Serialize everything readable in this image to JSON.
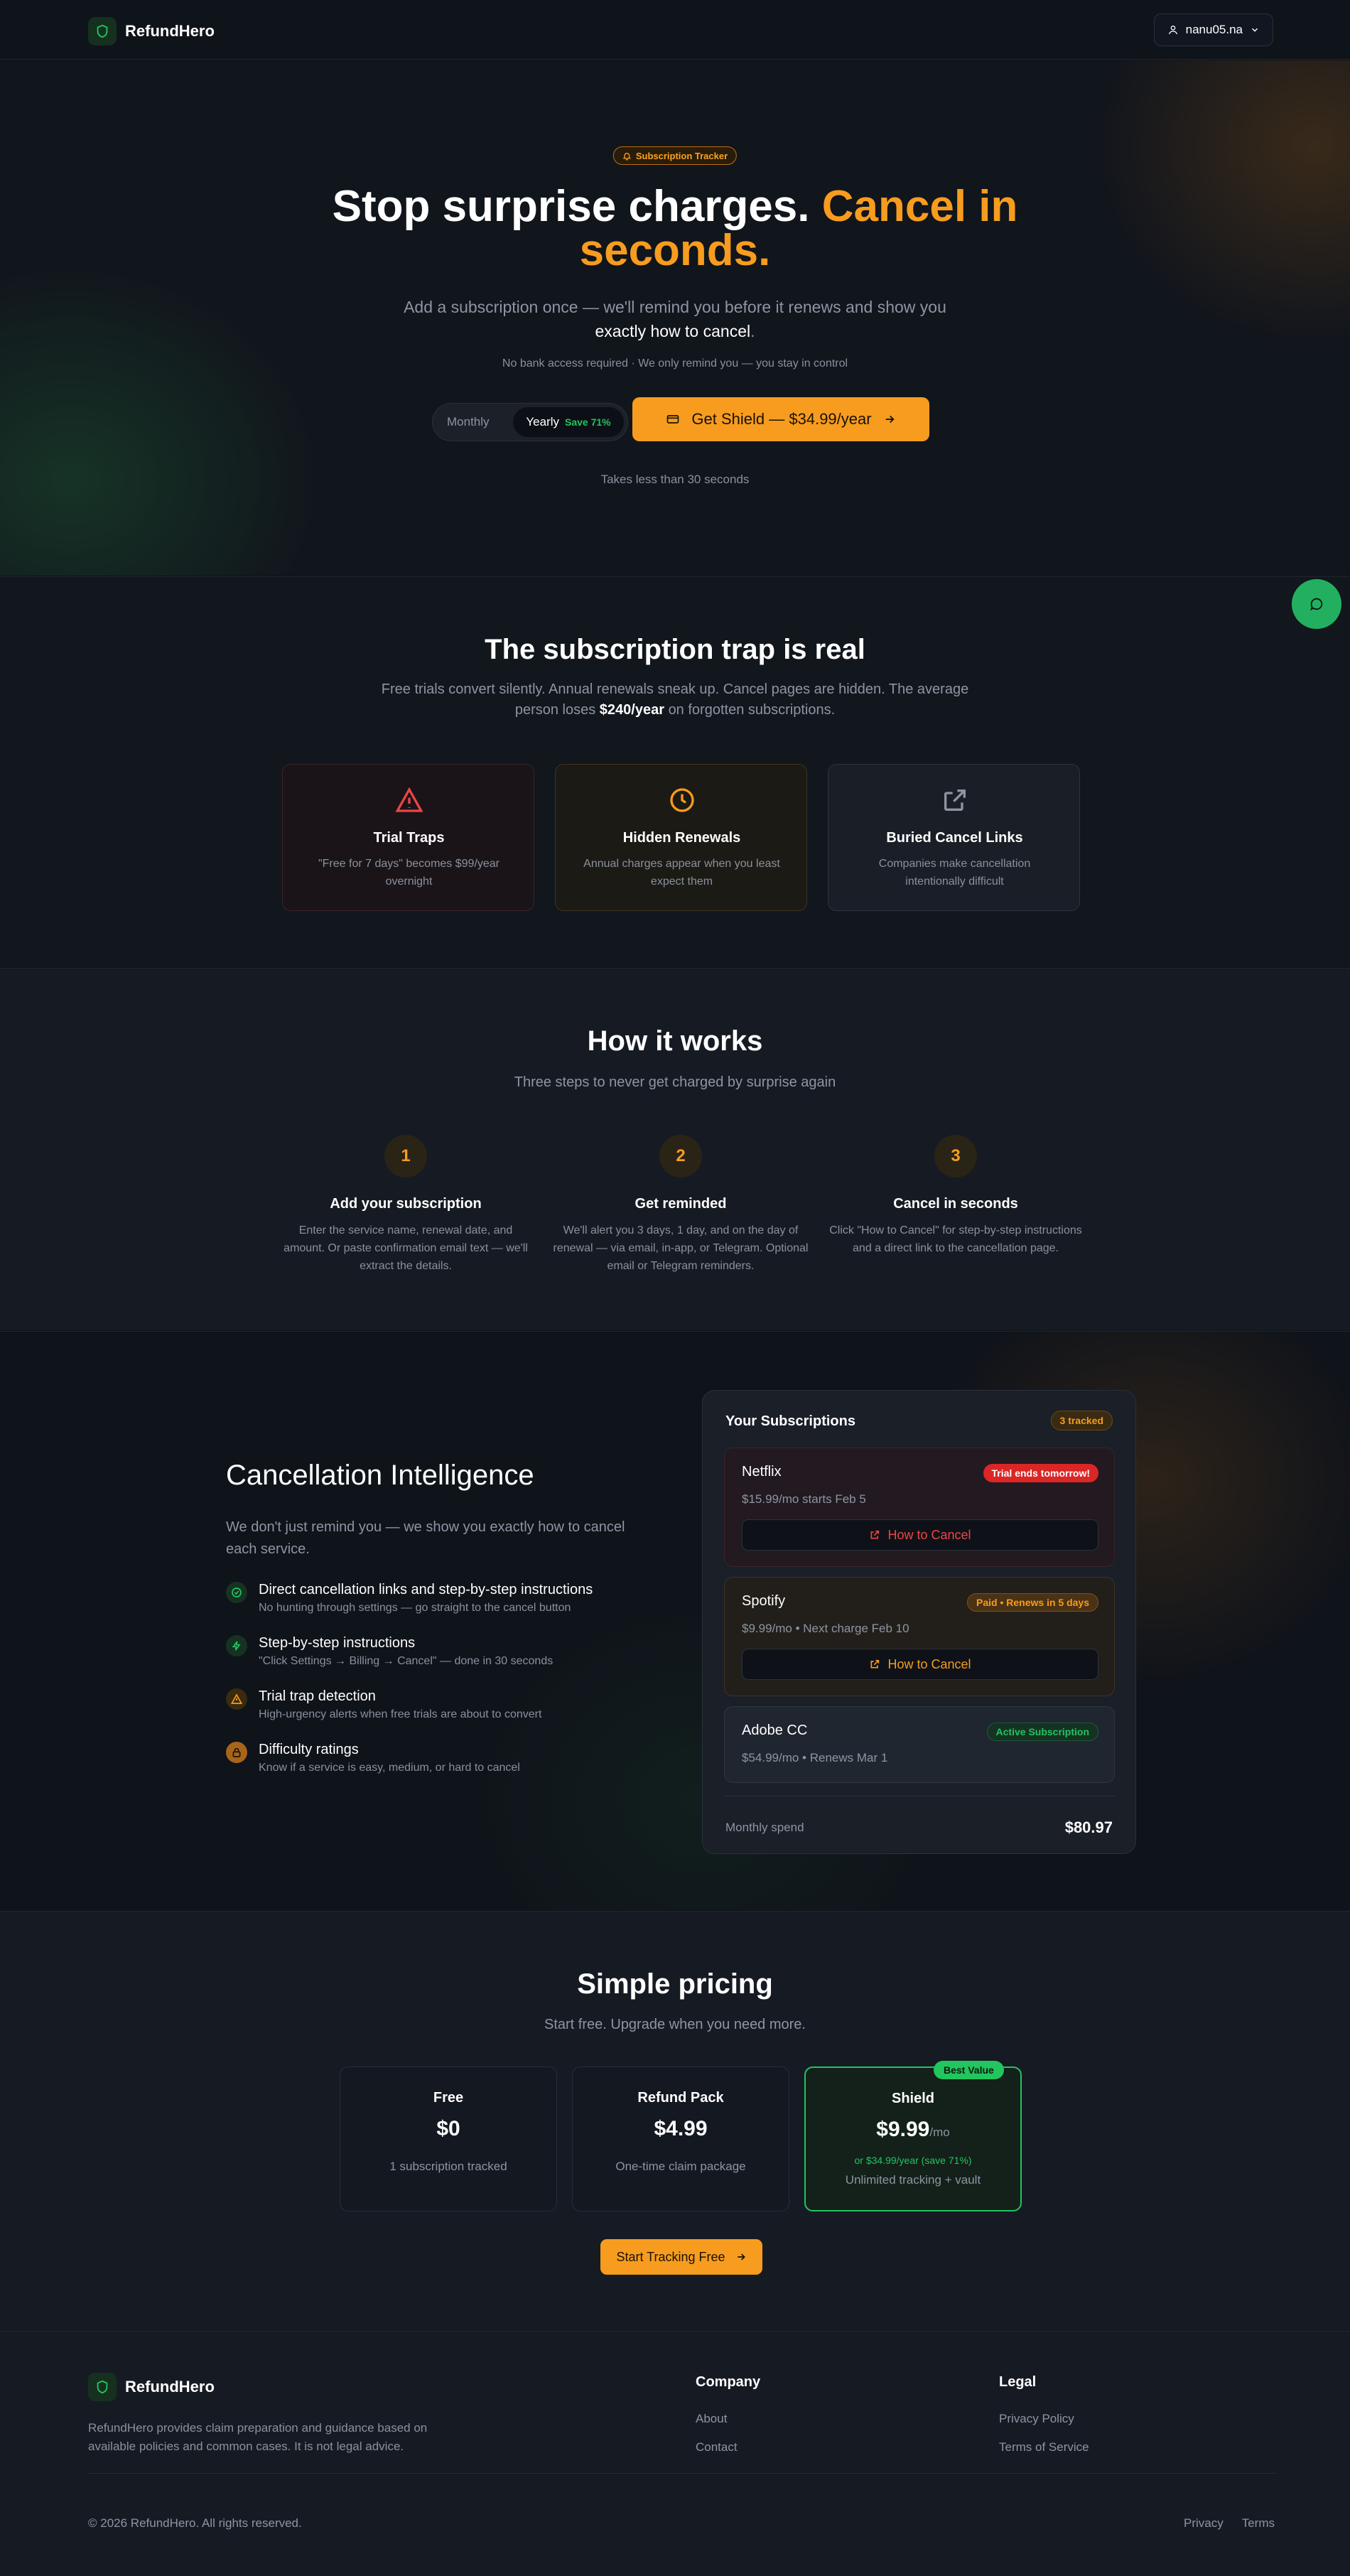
{
  "header": {
    "brand": "RefundHero",
    "user": "nanu05.na"
  },
  "hero": {
    "pill": "Subscription Tracker",
    "title_white": "Stop surprise charges.",
    "title_orange_1": "Cancel in",
    "title_orange_2": "seconds.",
    "subtitle_1": "Add a subscription once — we'll remind you before it renews and show you",
    "subtitle_2_strong": "exactly how to cancel",
    "subtitle_2_end": ".",
    "note": "No bank access required · We only remind you — you stay in control",
    "toggle_monthly": "Monthly",
    "toggle_yearly": "Yearly",
    "toggle_save": "Save 71%",
    "cta": "Get Shield — $34.99/year",
    "takes": "Takes less than 30 seconds"
  },
  "trap": {
    "title": "The subscription trap is real",
    "desc_1": "Free trials convert silently. Annual renewals sneak up. Cancel pages are hidden. The average",
    "desc_2_start": "person loses",
    "desc_2_strong": "$240/year",
    "desc_2_end": "on forgotten subscriptions.",
    "cards": [
      {
        "title": "Trial Traps",
        "desc": "\"Free for 7 days\" becomes $99/year overnight",
        "icon": "warning-icon"
      },
      {
        "title": "Hidden Renewals",
        "desc": "Annual charges appear when you least expect them",
        "icon": "clock-icon"
      },
      {
        "title": "Buried Cancel Links",
        "desc": "Companies make cancellation intentionally difficult",
        "icon": "external-link-icon"
      }
    ]
  },
  "how": {
    "title": "How it works",
    "subtitle": "Three steps to never get charged by surprise again",
    "steps": [
      {
        "num": "1",
        "title": "Add your subscription",
        "desc": "Enter the service name, renewal date, and amount. Or paste confirmation email text — we'll extract the details."
      },
      {
        "num": "2",
        "title": "Get reminded",
        "desc": "We'll alert you 3 days, 1 day, and on the day of renewal — via email, in-app, or Telegram. Optional email or Telegram reminders."
      },
      {
        "num": "3",
        "title": "Cancel in seconds",
        "desc": "Click \"How to Cancel\" for step-by-step instructions and a direct link to the cancellation page."
      }
    ]
  },
  "intel": {
    "title": "Cancellation Intelligence",
    "desc": "We don't just remind you — we show you exactly how to cancel each service.",
    "features": [
      {
        "title": "Direct cancellation links and step-by-step instructions",
        "desc": "No hunting through settings — go straight to the cancel button",
        "icon": "check-circle-icon"
      },
      {
        "title": "Step-by-step instructions",
        "desc": "\"Click Settings → Billing → Cancel\" — done in 30 seconds",
        "icon": "lightning-icon"
      },
      {
        "title": "Trial trap detection",
        "desc": "High-urgency alerts when free trials are about to convert",
        "icon": "warning-icon"
      },
      {
        "title": "Difficulty ratings",
        "desc": "Know if a service is easy, medium, or hard to cancel",
        "icon": "lock-icon"
      }
    ],
    "panel": {
      "title": "Your Subscriptions",
      "count": "3 tracked",
      "items": [
        {
          "name": "Netflix",
          "badge": "Trial ends tomorrow!",
          "price": "$15.99/mo starts Feb 5",
          "button": "How to Cancel"
        },
        {
          "name": "Spotify",
          "badge": "Paid • Renews in 5 days",
          "price": "$9.99/mo • Next charge Feb 10",
          "button": "How to Cancel"
        },
        {
          "name": "Adobe CC",
          "badge": "Active Subscription",
          "price": "$54.99/mo • Renews Mar 1"
        }
      ],
      "spend_label": "Monthly spend",
      "spend_value": "$80.97"
    }
  },
  "pricing": {
    "title": "Simple pricing",
    "subtitle": "Start free. Upgrade when you need more.",
    "plans": [
      {
        "name": "Free",
        "price": "$0",
        "desc": "1 subscription tracked"
      },
      {
        "name": "Refund Pack",
        "price": "$4.99",
        "desc": "One-time claim package"
      },
      {
        "name": "Shield",
        "price": "$9.99",
        "unit": "/mo",
        "yearly": "or $34.99/year (save 71%)",
        "desc": "Unlimited tracking + vault",
        "badge": "Best Value"
      }
    ],
    "cta": "Start Tracking Free"
  },
  "footer": {
    "brand": "RefundHero",
    "desc": "RefundHero provides claim preparation and guidance based on available policies and common cases. It is not legal advice.",
    "company_title": "Company",
    "company_links": [
      "About",
      "Contact"
    ],
    "legal_title": "Legal",
    "legal_links": [
      "Privacy Policy",
      "Terms of Service"
    ],
    "copyright": "© 2026 RefundHero. All rights reserved.",
    "bottom_links": [
      "Privacy",
      "Terms"
    ]
  },
  "colors": {
    "accent": "#f79c1e",
    "green": "#22c55e",
    "danger": "#dc2626",
    "background": "#0f131a"
  }
}
